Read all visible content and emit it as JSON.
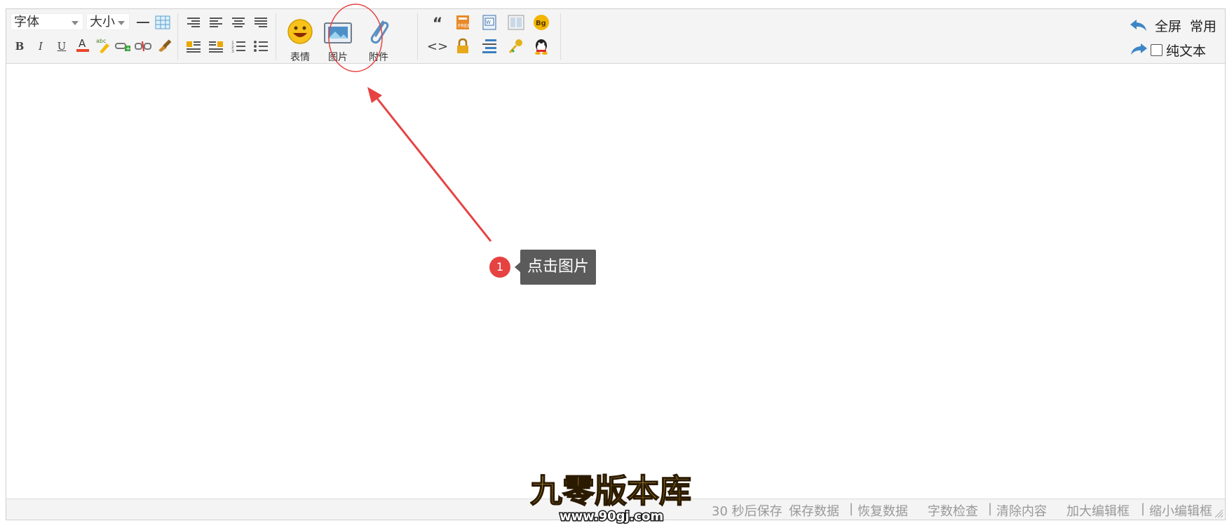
{
  "toolbar": {
    "font_select": "字体",
    "size_select": "大小",
    "big_buttons": {
      "emoji": "表情",
      "image": "图片",
      "attachment": "附件"
    },
    "right": {
      "fullscreen": "全屏",
      "common": "常用",
      "plain_text": "纯文本",
      "plain_text_checked": false
    }
  },
  "statusbar": {
    "autosave": "30 秒后保存",
    "save_data": "保存数据",
    "restore_data": "恢复数据",
    "word_check": "字数检查",
    "clear_content": "清除内容",
    "enlarge": "加大编辑框",
    "shrink": "缩小编辑框",
    "separator": "|"
  },
  "annotation": {
    "step_number": "1",
    "text": "点击图片",
    "color": "#e64242"
  },
  "watermark": {
    "title": "九零版本库",
    "url": "www.90gj.com"
  }
}
